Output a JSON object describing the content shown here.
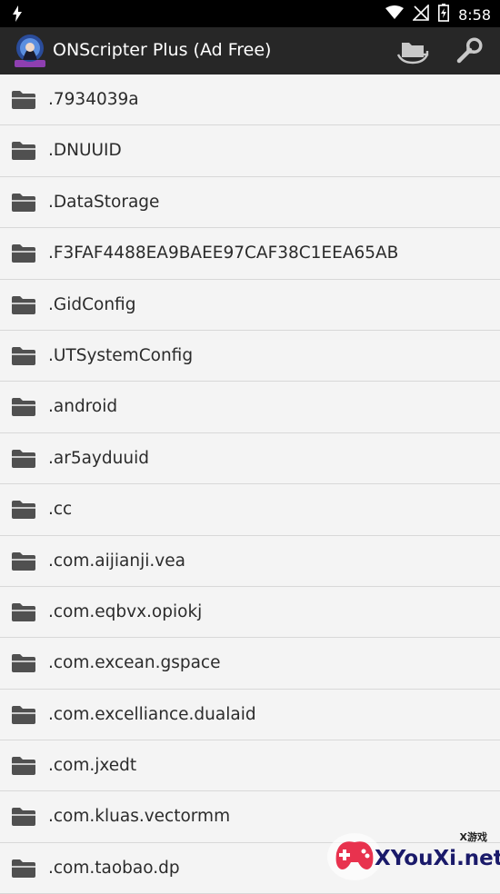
{
  "status": {
    "time": "8:58"
  },
  "appbar": {
    "title": "ONScripter Plus (Ad Free)"
  },
  "files": [
    ".7934039a",
    ".DNUUID",
    ".DataStorage",
    ".F3FAF4488EA9BAEE97CAF38C1EEA65AB",
    ".GidConfig",
    ".UTSystemConfig",
    ".android",
    ".ar5ayduuid",
    ".cc",
    ".com.aijianji.vea",
    ".com.eqbvx.opiokj",
    ".com.excean.gspace",
    ".com.excelliance.dualaid",
    ".com.jxedt",
    ".com.kluas.vectormm",
    ".com.taobao.dp"
  ],
  "watermark": {
    "text": "XYouXi.net",
    "small": "X游戏"
  },
  "colors": {
    "appbar": "#272727",
    "statusbar": "#000000",
    "list_bg": "#f4f4f4",
    "folder": "#505050"
  }
}
